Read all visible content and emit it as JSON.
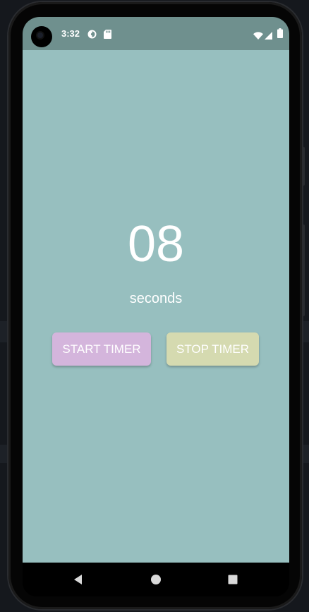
{
  "status_bar": {
    "time": "3:32",
    "icons": [
      "camera-cutout-icon",
      "notification-icon",
      "sd-card-icon",
      "wifi-icon",
      "signal-icon",
      "battery-icon"
    ]
  },
  "timer": {
    "value": "08",
    "unit_label": "seconds"
  },
  "buttons": {
    "start_label": "START TIMER",
    "stop_label": "STOP TIMER"
  },
  "nav_bar": {
    "icons": [
      "back-icon",
      "home-icon",
      "recents-icon"
    ]
  },
  "colors": {
    "background": "#97bfbf",
    "status_bar": "#6f908e",
    "start_button": "#d4b5dc",
    "stop_button": "#d5dab0",
    "text": "#ffffff"
  }
}
